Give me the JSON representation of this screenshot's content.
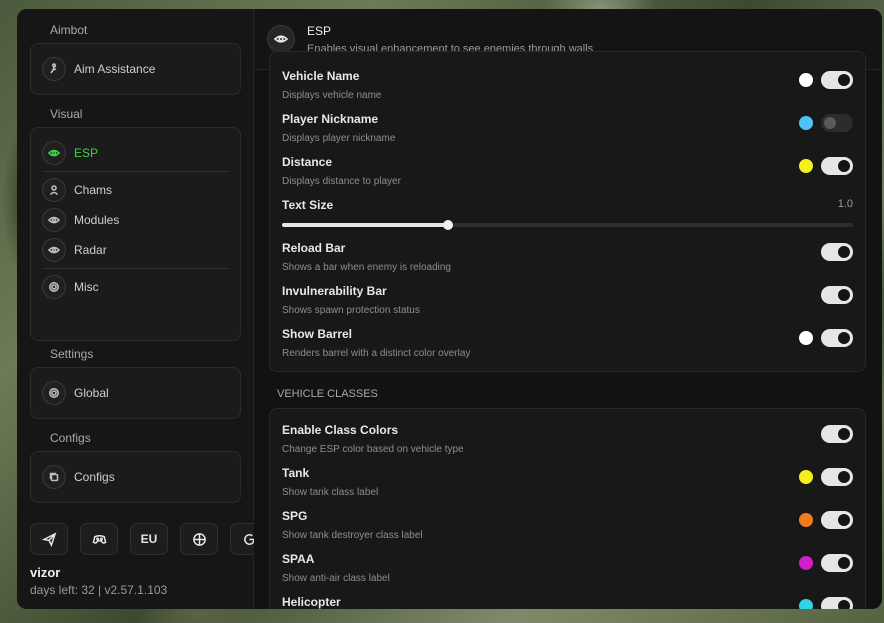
{
  "sidebar": {
    "sections": [
      {
        "title": "Aimbot",
        "items": [
          {
            "label": "Aim Assistance"
          }
        ]
      },
      {
        "title": "Visual",
        "items": [
          {
            "label": "ESP"
          },
          {
            "label": "Chams"
          },
          {
            "label": "Modules"
          },
          {
            "label": "Radar"
          },
          {
            "label": "Misc"
          }
        ]
      },
      {
        "title": "Settings",
        "items": [
          {
            "label": "Global"
          }
        ]
      },
      {
        "title": "Configs",
        "items": [
          {
            "label": "Configs"
          }
        ]
      }
    ],
    "region_label": "EU",
    "user": {
      "name": "vizor",
      "info": "days left: 32 | v2.57.1.103"
    }
  },
  "header": {
    "title": "ESP",
    "subtitle": "Enables visual enhancement to see enemies through walls"
  },
  "esp_rows": [
    {
      "title": "Vehicle Name",
      "desc": "Displays vehicle name",
      "color": "#ffffff",
      "on": true
    },
    {
      "title": "Player Nickname",
      "desc": "Displays player nickname",
      "color": "#4fc3f7",
      "on": false
    },
    {
      "title": "Distance",
      "desc": "Displays distance to player",
      "color": "#f5ef1c",
      "on": true
    },
    {
      "title": "Text Size",
      "value": "1.0",
      "fraction": 0.29
    },
    {
      "title": "Reload Bar",
      "desc": "Shows a bar when enemy is reloading",
      "on": true
    },
    {
      "title": "Invulnerability Bar",
      "desc": "Shows spawn protection status",
      "on": true
    },
    {
      "title": "Show Barrel",
      "desc": "Renders barrel with a distinct color overlay",
      "color": "#ffffff",
      "on": true
    }
  ],
  "vehicle_classes_label": "VEHICLE CLASSES",
  "class_rows": [
    {
      "title": "Enable Class Colors",
      "desc": "Change ESP color based on vehicle type",
      "on": true
    },
    {
      "title": "Tank",
      "desc": "Show tank class label",
      "color": "#f5ef1c",
      "on": true
    },
    {
      "title": "SPG",
      "desc": "Show tank destroyer class label",
      "color": "#f27c1b",
      "on": true
    },
    {
      "title": "SPAA",
      "desc": "Show anti-air class label",
      "color": "#d21fc7",
      "on": true
    },
    {
      "title": "Helicopter",
      "desc": "",
      "color": "#2fd5e8",
      "on": true
    }
  ],
  "colors": {
    "accent": "#3fd14a",
    "toggle_on": "#e6e6e6",
    "toggle_off": "#2c2c2c"
  }
}
